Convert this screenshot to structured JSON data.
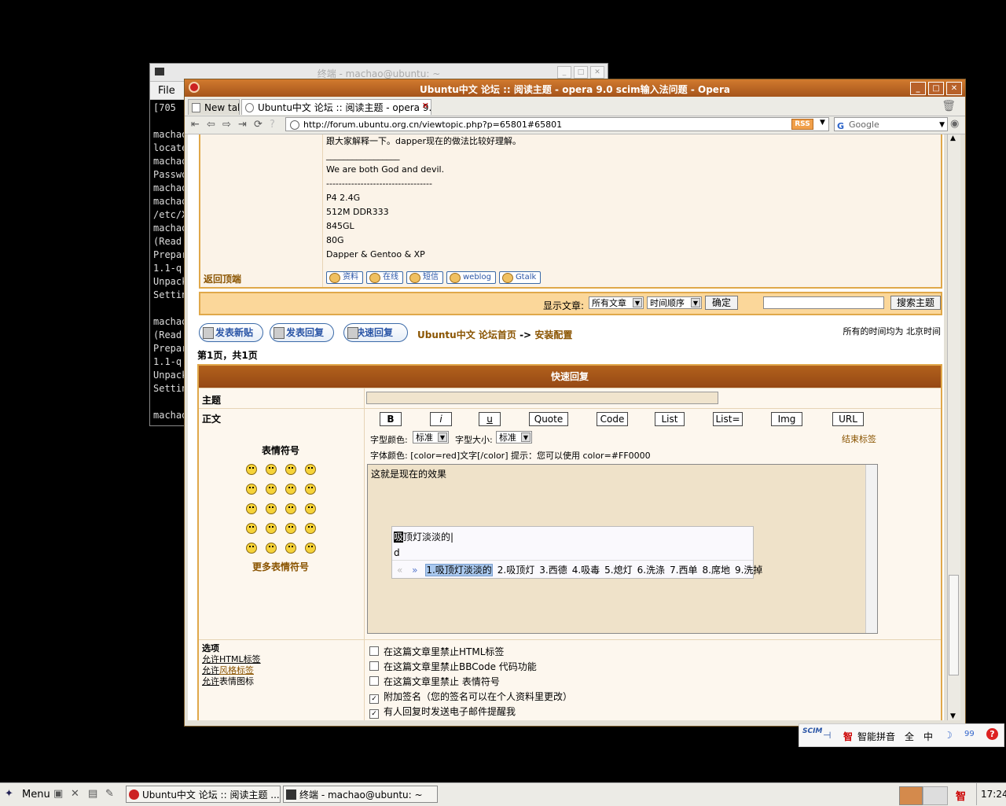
{
  "terminal": {
    "title": "终端 - machao@ubuntu: ~",
    "menu_file": "File",
    "lines": [
      "[705",
      "",
      "machao",
      "locate",
      "machao",
      "Passwo",
      "machao",
      "machao",
      "/etc/X",
      "machao",
      "(Read:",
      "Prepar",
      "1.1-q",
      "Unpack",
      "Settin",
      "",
      "machao",
      "(Read:",
      "Prepar",
      "1.1-q",
      "Unpack",
      "Settin",
      "",
      "machao"
    ]
  },
  "opera": {
    "title": "Ubuntu中文 论坛 :: 阅读主题 - opera 9.0 scim输入法问题 - Opera",
    "tabs": [
      {
        "label": "New tab"
      },
      {
        "label": "Ubuntu中文 论坛 :: 阅读主题 - opera 9.0..."
      }
    ],
    "url": "http://forum.ubuntu.org.cn/viewtopic.php?p=65801#65801",
    "rss": "RSS",
    "search_placeholder": "Google",
    "search_g": "G"
  },
  "post": {
    "signature_lines": [
      "跟大家解释一下。dapper现在的做法比较好理解。",
      "_________________",
      "We are both God and devil.",
      "----------------------------------",
      "P4 2.4G",
      "512M DDR333",
      "845GL",
      "80G",
      "Dapper & Gentoo & XP"
    ],
    "back_to_top": "返回顶端",
    "buttons": [
      "资料",
      "在线",
      "短信",
      "weblog",
      "Gtalk"
    ]
  },
  "sortbar": {
    "show_posts_label": "显示文章:",
    "show_posts_value": "所有文章",
    "order_value": "时间顺序",
    "confirm": "确定",
    "search_topic": "搜索主题"
  },
  "actions": {
    "new_topic": "发表新贴",
    "reply": "发表回复",
    "quick_reply": "快速回复",
    "breadcrumb_home": "Ubuntu中文 论坛首页",
    "breadcrumb_sep": "->",
    "breadcrumb_forum": "安装配置",
    "timezone": "所有的时间均为 北京时间",
    "pageinfo": "第1页，共1页"
  },
  "quickreply": {
    "header": "快速回复",
    "subject_label": "主题",
    "body_label": "正文",
    "format_buttons": [
      "B",
      "i",
      "u",
      "Quote",
      "Code",
      "List",
      "List=",
      "Img",
      "URL"
    ],
    "font_color_label": "字型颜色:",
    "font_color_value": "标准",
    "font_size_label": "字型大小:",
    "font_size_value": "标准",
    "close_tags": "结束标签",
    "hint": "字体颜色: [color=red]文字[/color]  提示：您可以使用 color=#FF0000",
    "smilies_title": "表情符号",
    "more_smilies": "更多表情符号",
    "textarea_text": "这就是现在的效果",
    "options_label": "选项",
    "allow_html": "允许HTML标签",
    "allow_bbcode_a": "允许",
    "allow_bbcode_b": "风格标签",
    "allow_smilies_a": "允许",
    "allow_smilies_b": "表情图标",
    "options": [
      {
        "label": "在这篇文章里禁止HTML标签",
        "checked": false
      },
      {
        "label": "在这篇文章里禁止BBCode 代码功能",
        "checked": false
      },
      {
        "label": "在这篇文章里禁止 表情符号",
        "checked": false
      },
      {
        "label": "附加签名（您的签名可以在个人资料里更改）",
        "checked": true
      },
      {
        "label": "有人回复时发送电子邮件提醒我",
        "checked": true
      }
    ]
  },
  "ime": {
    "preedit_first": "吸",
    "preedit_rest": "顶灯淡淡的",
    "aux": "d",
    "nav_prev": "«",
    "nav_next": "»",
    "candidates": [
      "1.吸顶灯淡淡的",
      "2.吸顶灯",
      "3.西德",
      "4.吸毒",
      "5.熄灯",
      "6.洗涤",
      "7.西单",
      "8.席地",
      "9.洗掉"
    ]
  },
  "scim": {
    "mode": "智能拼音",
    "full": "全",
    "zh": "中",
    "icon_zhi": "智",
    "logo": "SCIM",
    "quotes": "99"
  },
  "taskbar": {
    "menu": "Menu",
    "task1": "Ubuntu中文 论坛 :: 阅读主题 ...",
    "task2": "终端 - machao@ubuntu: ~",
    "tray_zhi": "智",
    "clock": "17:24"
  }
}
